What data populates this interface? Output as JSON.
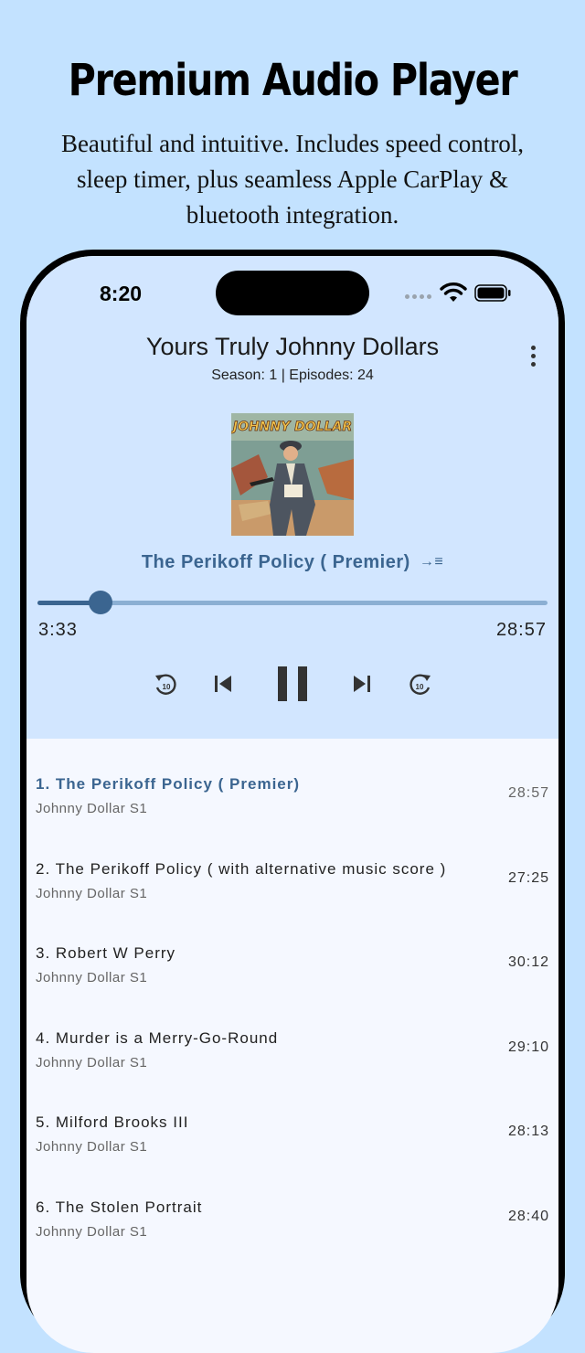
{
  "promo": {
    "headline": "Premium Audio Player",
    "subtext": "Beautiful and intuitive. Includes speed control, sleep timer, plus seamless Apple CarPlay & bluetooth integration."
  },
  "status_bar": {
    "time": "8:20"
  },
  "header": {
    "title": "Yours Truly Johnny Dollars",
    "meta": "Season: 1 | Episodes: 24"
  },
  "cover_art": {
    "text": "JOHNNY DOLLAR"
  },
  "now_playing": {
    "title": "The Perikoff Policy ( Premier)",
    "queue_icon": "→≡",
    "elapsed": "3:33",
    "total": "28:57",
    "progress_fraction": 0.123
  },
  "controls": {
    "rewind_icon": "rewind-10-icon",
    "prev_icon": "skip-previous-icon",
    "pause_icon": "pause-icon",
    "next_icon": "skip-next-icon",
    "forward_icon": "forward-10-icon",
    "skip_seconds": "10"
  },
  "colors": {
    "accent": "#3b6590",
    "player_bg": "#d2e6ff",
    "promo_bg": "#c3e2ff"
  },
  "episodes": [
    {
      "title": "1. The Perikoff Policy ( Premier)",
      "artist": "Johnny Dollar S1",
      "duration": "28:57",
      "active": true
    },
    {
      "title": "2.  The Perikoff Policy ( with alternative music score )",
      "artist": "Johnny Dollar S1",
      "duration": "27:25"
    },
    {
      "title": "3.  Robert W Perry",
      "artist": "Johnny Dollar S1",
      "duration": "30:12"
    },
    {
      "title": "4.  Murder is a Merry-Go-Round",
      "artist": "Johnny Dollar S1",
      "duration": "29:10"
    },
    {
      "title": "5. Milford Brooks III",
      "artist": "Johnny Dollar S1",
      "duration": "28:13"
    },
    {
      "title": "6. The Stolen Portrait",
      "artist": "Johnny Dollar S1",
      "duration": "28:40"
    }
  ]
}
